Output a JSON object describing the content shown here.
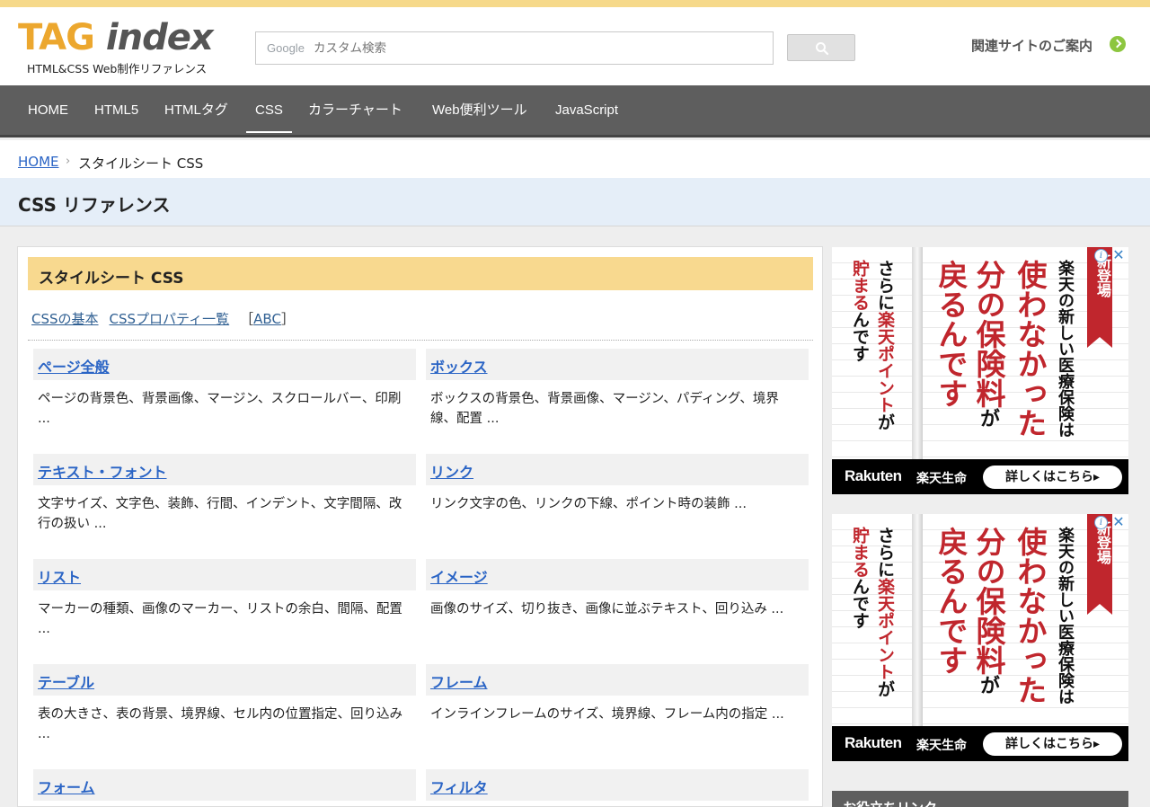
{
  "header": {
    "logo_tag": "TAG",
    "logo_index": "index",
    "logo_sub": "HTML&CSS Web制作リファレンス",
    "search_brand": "Google",
    "search_placeholder": "カスタム検索",
    "related": "関連サイトのご案内"
  },
  "nav": {
    "items": [
      {
        "label": "HOME"
      },
      {
        "label": "HTML5"
      },
      {
        "label": "HTMLタグ"
      },
      {
        "label": "CSS"
      },
      {
        "label": "カラーチャート"
      },
      {
        "label": "Web便利ツール"
      },
      {
        "label": "JavaScript"
      }
    ],
    "active": "CSS"
  },
  "breadcrumb": {
    "home": "HOME",
    "separator": "›",
    "current": "スタイルシート CSS"
  },
  "page_title": "CSS リファレンス",
  "section": {
    "title": "スタイルシート CSS",
    "links": [
      "CSSの基本",
      "CSSプロパティ一覧"
    ],
    "abc_open": "［",
    "abc": "ABC",
    "abc_close": "］"
  },
  "categories": [
    {
      "title": "ページ全般",
      "desc": "ページの背景色、背景画像、マージン、スクロールバー、印刷 ..."
    },
    {
      "title": "ボックス",
      "desc": "ボックスの背景色、背景画像、マージン、パディング、境界線、配置 ..."
    },
    {
      "title": "テキスト・フォント",
      "desc": "文字サイズ、文字色、装飾、行間、インデント、文字間隔、改行の扱い ..."
    },
    {
      "title": "リンク",
      "desc": "リンク文字の色、リンクの下線、ポイント時の装飾 ..."
    },
    {
      "title": "リスト",
      "desc": "マーカーの種類、画像のマーカー、リストの余白、間隔、配置 ..."
    },
    {
      "title": "イメージ",
      "desc": "画像のサイズ、切り抜き、画像に並ぶテキスト、回り込み ..."
    },
    {
      "title": "テーブル",
      "desc": "表の大きさ、表の背景、境界線、セル内の位置指定、回り込み ..."
    },
    {
      "title": "フレーム",
      "desc": "インラインフレームのサイズ、境界線、フレーム内の指定 ..."
    },
    {
      "title": "フォーム",
      "desc": ""
    },
    {
      "title": "フィルタ",
      "desc": ""
    }
  ],
  "ads": [
    {
      "ribbon": "新登場",
      "col1": "楽天の新しい医療保険は",
      "col2": "使わなかった",
      "col3": "分の保険料",
      "col3b": "が",
      "col4": "戻るんです",
      "col5a": "さらに",
      "col5b": "楽天ポイント",
      "col5c": "が",
      "col6a": "貯まる",
      "col6b": "んです",
      "brand": "Rakuten",
      "brand_jp": "楽天生命",
      "cta": "詳しくはこちら▸",
      "info": "i",
      "close": "✕"
    },
    {
      "ribbon": "新登場",
      "col1": "楽天の新しい医療保険は",
      "col2": "使わなかった",
      "col3": "分の保険料",
      "col3b": "が",
      "col4": "戻るんです",
      "col5a": "さらに",
      "col5b": "楽天ポイント",
      "col5c": "が",
      "col6a": "貯まる",
      "col6b": "んです",
      "brand": "Rakuten",
      "brand_jp": "楽天生命",
      "cta": "詳しくはこちら▸",
      "info": "i",
      "close": "✕"
    }
  ],
  "side_box": {
    "title": "お役立ちリンク"
  },
  "colors": {
    "accent": "#f8d98f",
    "nav_bg": "#5e5e5e",
    "link": "#2a64c5",
    "ad_red": "#c0262d"
  },
  "icons": {
    "search": "search-icon",
    "related_arrow": "chevron-right-icon"
  }
}
